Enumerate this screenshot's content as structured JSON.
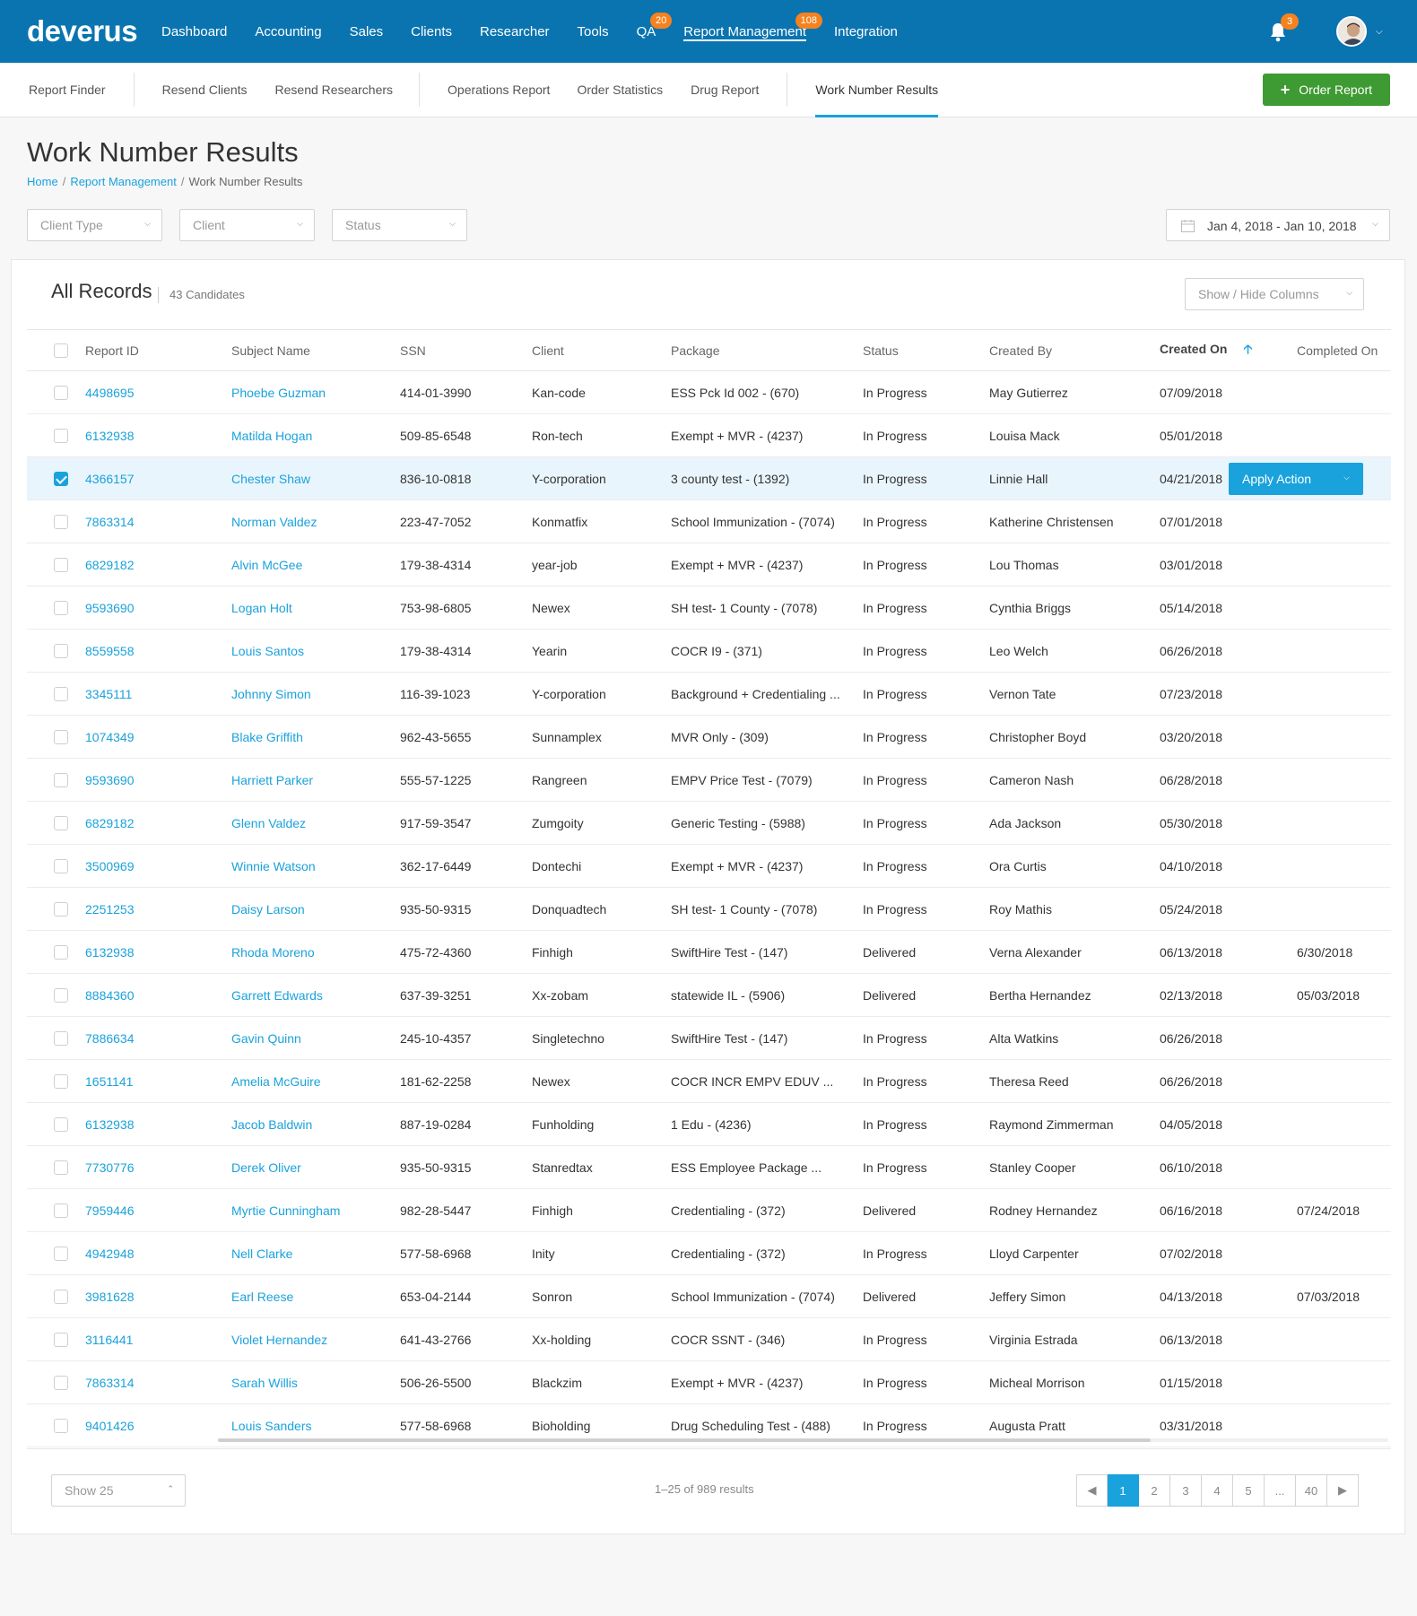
{
  "brand": "deverus",
  "nav": [
    {
      "label": "Dashboard"
    },
    {
      "label": "Accounting"
    },
    {
      "label": "Sales"
    },
    {
      "label": "Clients"
    },
    {
      "label": "Researcher"
    },
    {
      "label": "Tools"
    },
    {
      "label": "QA",
      "badge": "20"
    },
    {
      "label": "Report Management",
      "badge": "108",
      "active": true
    },
    {
      "label": "Integration"
    }
  ],
  "notifications": {
    "count": "3",
    "icon": "bell-icon"
  },
  "subnav": {
    "items": [
      "Report Finder",
      "Resend Clients",
      "Resend Researchers",
      "Operations Report",
      "Order Statistics",
      "Drug Report",
      "Work Number Results"
    ],
    "order_button": "Order Report"
  },
  "page": {
    "title": "Work Number Results",
    "breadcrumb": [
      "Home",
      "Report Management",
      "Work Number Results"
    ]
  },
  "filters": {
    "client_type": "Client Type",
    "client": "Client",
    "status": "Status",
    "date_range": "Jan 4, 2018 - Jan 10, 2018"
  },
  "records": {
    "title": "All Records",
    "count_label": "43 Candidates",
    "show_hide": "Show / Hide Columns",
    "apply_action": "Apply Action",
    "columns": [
      "Report ID",
      "Subject Name",
      "SSN",
      "Client",
      "Package",
      "Status",
      "Created By",
      "Created On",
      "Completed On"
    ],
    "rows": [
      [
        "4498695",
        "Phoebe Guzman",
        "414-01-3990",
        "Kan-code",
        "ESS Pck Id 002 - (670)",
        "In Progress",
        "May Gutierrez",
        "07/09/2018",
        ""
      ],
      [
        "6132938",
        "Matilda Hogan",
        "509-85-6548",
        "Ron-tech",
        "Exempt + MVR - (4237)",
        "In Progress",
        "Louisa Mack",
        "05/01/2018",
        ""
      ],
      [
        "4366157",
        "Chester Shaw",
        "836-10-0818",
        "Y-corporation",
        "3 county test - (1392)",
        "In Progress",
        "Linnie Hall",
        "04/21/2018",
        ""
      ],
      [
        "7863314",
        "Norman Valdez",
        "223-47-7052",
        "Konmatfix",
        "School Immunization - (7074)",
        "In Progress",
        "Katherine Christensen",
        "07/01/2018",
        ""
      ],
      [
        "6829182",
        "Alvin McGee",
        "179-38-4314",
        "year-job",
        "Exempt + MVR - (4237)",
        "In Progress",
        "Lou Thomas",
        "03/01/2018",
        ""
      ],
      [
        "9593690",
        "Logan Holt",
        "753-98-6805",
        "Newex",
        "SH test- 1 County - (7078)",
        "In Progress",
        "Cynthia Briggs",
        "05/14/2018",
        ""
      ],
      [
        "8559558",
        "Louis Santos",
        "179-38-4314",
        "Yearin",
        "COCR I9 - (371)",
        "In Progress",
        "Leo Welch",
        "06/26/2018",
        ""
      ],
      [
        "3345111",
        "Johnny Simon",
        "116-39-1023",
        "Y-corporation",
        "Background + Credentialing ...",
        "In Progress",
        "Vernon Tate",
        "07/23/2018",
        ""
      ],
      [
        "1074349",
        "Blake Griffith",
        "962-43-5655",
        "Sunnamplex",
        "MVR Only - (309)",
        "In Progress",
        "Christopher Boyd",
        "03/20/2018",
        ""
      ],
      [
        "9593690",
        "Harriett Parker",
        "555-57-1225",
        "Rangreen",
        "EMPV Price Test - (7079)",
        "In Progress",
        "Cameron Nash",
        "06/28/2018",
        ""
      ],
      [
        "6829182",
        "Glenn Valdez",
        "917-59-3547",
        "Zumgoity",
        "Generic Testing - (5988)",
        "In Progress",
        "Ada Jackson",
        "05/30/2018",
        ""
      ],
      [
        "3500969",
        "Winnie Watson",
        "362-17-6449",
        "Dontechi",
        "Exempt + MVR - (4237)",
        "In Progress",
        "Ora Curtis",
        "04/10/2018",
        ""
      ],
      [
        "2251253",
        "Daisy Larson",
        "935-50-9315",
        "Donquadtech",
        "SH test- 1 County - (7078)",
        "In Progress",
        "Roy Mathis",
        "05/24/2018",
        ""
      ],
      [
        "6132938",
        "Rhoda Moreno",
        "475-72-4360",
        "Finhigh",
        "SwiftHire Test - (147)",
        "Delivered",
        "Verna Alexander",
        "06/13/2018",
        "6/30/2018"
      ],
      [
        "8884360",
        "Garrett Edwards",
        "637-39-3251",
        "Xx-zobam",
        "statewide IL - (5906)",
        "Delivered",
        "Bertha Hernandez",
        "02/13/2018",
        "05/03/2018"
      ],
      [
        "7886634",
        "Gavin Quinn",
        "245-10-4357",
        "Singletechno",
        "SwiftHire Test - (147)",
        "In Progress",
        "Alta Watkins",
        "06/26/2018",
        ""
      ],
      [
        "1651141",
        "Amelia McGuire",
        "181-62-2258",
        "Newex",
        "COCR INCR EMPV EDUV ...",
        "In Progress",
        "Theresa Reed",
        "06/26/2018",
        ""
      ],
      [
        "6132938",
        "Jacob Baldwin",
        "887-19-0284",
        "Funholding",
        "1 Edu - (4236)",
        "In Progress",
        "Raymond Zimmerman",
        "04/05/2018",
        ""
      ],
      [
        "7730776",
        "Derek Oliver",
        "935-50-9315",
        "Stanredtax",
        "ESS Employee Package ...",
        "In Progress",
        "Stanley Cooper",
        "06/10/2018",
        ""
      ],
      [
        "7959446",
        "Myrtie Cunningham",
        "982-28-5447",
        "Finhigh",
        "Credentialing - (372)",
        "Delivered",
        "Rodney Hernandez",
        "06/16/2018",
        "07/24/2018"
      ],
      [
        "4942948",
        "Nell Clarke",
        "577-58-6968",
        "Inity",
        "Credentialing - (372)",
        "In Progress",
        "Lloyd Carpenter",
        "07/02/2018",
        ""
      ],
      [
        "3981628",
        "Earl Reese",
        "653-04-2144",
        "Sonron",
        "School Immunization - (7074)",
        "Delivered",
        "Jeffery Simon",
        "04/13/2018",
        "07/03/2018"
      ],
      [
        "3116441",
        "Violet Hernandez",
        "641-43-2766",
        "Xx-holding",
        "COCR SSNT - (346)",
        "In Progress",
        "Virginia Estrada",
        "06/13/2018",
        ""
      ],
      [
        "7863314",
        "Sarah Willis",
        "506-26-5500",
        "Blackzim",
        "Exempt + MVR - (4237)",
        "In Progress",
        "Micheal Morrison",
        "01/15/2018",
        ""
      ],
      [
        "9401426",
        "Louis Sanders",
        "577-58-6968",
        "Bioholding",
        "Drug Scheduling Test - (488)",
        "In Progress",
        "Augusta Pratt",
        "03/31/2018",
        ""
      ]
    ],
    "selected_row": 2
  },
  "footer": {
    "show": "Show 25",
    "results": "1–25 of 989 results",
    "pages": [
      "1",
      "2",
      "3",
      "4",
      "5",
      "...",
      "40"
    ],
    "active_page": "1"
  },
  "colors": {
    "nav_bg": "#0a74b0",
    "accent": "#1aa2dc",
    "order_btn": "#3e9a32",
    "badge": "#f5821f"
  }
}
